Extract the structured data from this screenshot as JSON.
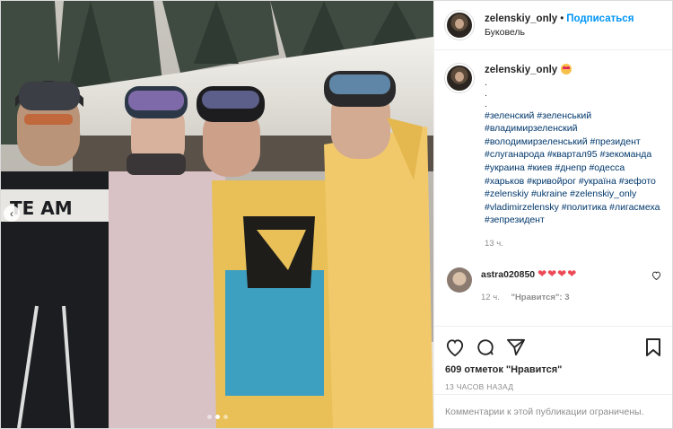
{
  "post": {
    "username": "zelenskiy_only",
    "separator": "•",
    "follow_label": "Подписаться",
    "location": "Буковель"
  },
  "caption": {
    "username": "zelenskiy_only",
    "emoji": "face-with-heart-eyes-emoji",
    "dots": [
      ".",
      ".",
      "."
    ],
    "hashtags": "#зеленский #зеленський #владимирзеленский #володимирзеленський #президент #слуганарода #квартал95 #зекоманда #украина #киев #днепр #одесса #харьков #кривойрог #україна #зефото #zelenskiy #ukraine #zelenskiy_only #vladimirzelensky #политика #лигасмеха #зепрезидент",
    "time": "13 ч."
  },
  "comment": {
    "username": "astra020850",
    "hearts": "❤❤❤❤",
    "time": "12 ч.",
    "likes": "\"Нравится\": 3"
  },
  "actions": {
    "likes_count": "609 отметок \"Нравится\"",
    "time_ago": "13 ЧАСОВ НАЗАД"
  },
  "footer": {
    "comments_disabled": "Комментарии к этой публикации ограничены."
  },
  "carousel": {
    "prev_arrow": "‹",
    "total_dots": 3,
    "active_dot": 2
  },
  "colors": {
    "accent": "#0095f6",
    "hashtag": "#00376b",
    "heart": "#ed4956",
    "muted": "#8e8e8e"
  }
}
